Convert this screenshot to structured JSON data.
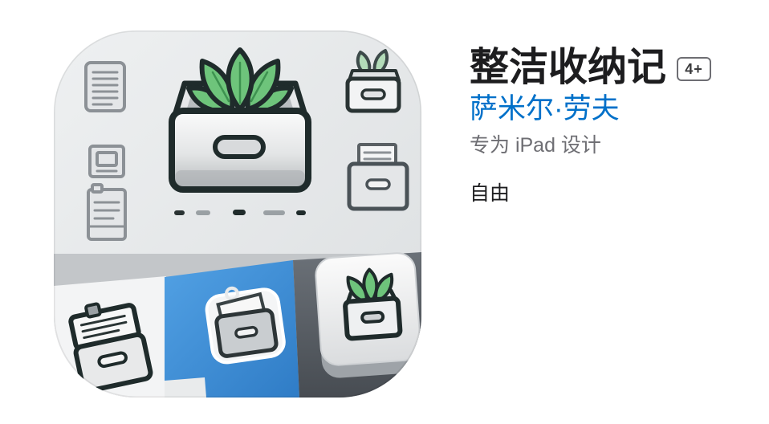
{
  "app": {
    "title": "整洁收纳记",
    "age_rating": "4+",
    "developer": "萨米尔·劳夫",
    "designed_for": "专为 iPad 设计",
    "price": "自由"
  },
  "icon": {
    "name": "storage-drawer-app-icon",
    "elements": [
      "storage-box-icon",
      "leaves-icon",
      "document-icon",
      "photo-frame-icon",
      "file-icon",
      "small-drawer-plant-icon",
      "document-drawer-icon",
      "clipboard-drawer-icon",
      "sticker-drawer-icon",
      "plant-drawer-button-icon"
    ]
  },
  "colors": {
    "title": "#1d1d1f",
    "developer_link": "#0070c9",
    "secondary_text": "#6e6e73",
    "badge_border": "#6e6e73",
    "icon_blue": "#3f8fd8",
    "leaf_green": "#6ec47b",
    "outline_dark": "#1f2b2b"
  }
}
